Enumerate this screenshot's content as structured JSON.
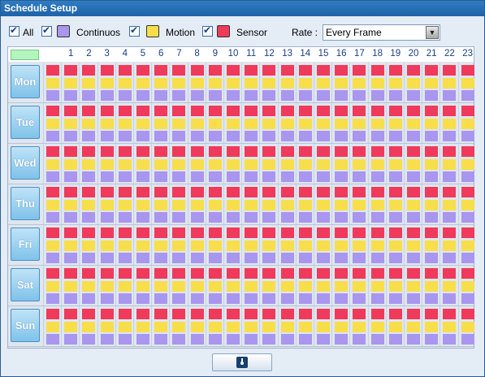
{
  "title": "Schedule Setup",
  "legend": {
    "all_label": "All",
    "items": [
      {
        "label": "Continuos",
        "color": "#a996ee"
      },
      {
        "label": "Motion",
        "color": "#f7de4a"
      },
      {
        "label": "Sensor",
        "color": "#ef3a5b"
      }
    ],
    "rate_label": "Rate :",
    "rate_value": "Every Frame"
  },
  "hours": [
    "1",
    "2",
    "3",
    "4",
    "5",
    "6",
    "7",
    "8",
    "9",
    "10",
    "11",
    "12",
    "13",
    "14",
    "15",
    "16",
    "17",
    "18",
    "19",
    "20",
    "21",
    "22",
    "23"
  ],
  "days": [
    "Mon",
    "Tue",
    "Wed",
    "Thu",
    "Fri",
    "Sat",
    "Sun"
  ],
  "footer": {
    "button_icon": "save-icon"
  }
}
